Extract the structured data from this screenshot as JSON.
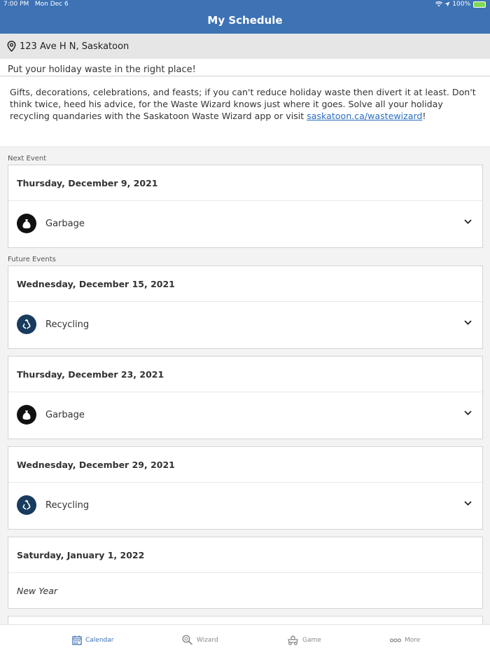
{
  "status": {
    "time": "7:00 PM",
    "date": "Mon Dec 6",
    "battery": "100%"
  },
  "header": {
    "title": "My Schedule"
  },
  "address": "123 Ave H  N, Saskatoon",
  "notice": {
    "title": "Put your holiday waste in the right place!",
    "body_before": "Gifts, decorations, celebrations, and feasts; if you can't reduce holiday waste then divert it at least. Don't think twice, heed his advice, for the Waste Wizard knows just where it goes. Solve all your holiday recycling quandaries with the Saskatoon Waste Wizard app or visit ",
    "link": "saskatoon.ca/wastewizard",
    "body_after": "!"
  },
  "sections": {
    "next": "Next Event",
    "future": "Future Events"
  },
  "events": [
    {
      "date": "Thursday, December 9, 2021",
      "type": "Garbage"
    },
    {
      "date": "Wednesday, December 15, 2021",
      "type": "Recycling"
    },
    {
      "date": "Thursday, December 23, 2021",
      "type": "Garbage"
    },
    {
      "date": "Wednesday, December 29, 2021",
      "type": "Recycling"
    },
    {
      "date": "Saturday, January 1, 2022",
      "note": "New Year"
    }
  ],
  "tabs": [
    {
      "label": "Calendar",
      "icon": "calendar-icon",
      "active": true
    },
    {
      "label": "Wizard",
      "icon": "magnifier-icon"
    },
    {
      "label": "Game",
      "icon": "game-icon"
    },
    {
      "label": "More",
      "icon": "more-icon"
    }
  ],
  "colors": {
    "primary": "#3d72b5",
    "recycling_icon": "#183b5e",
    "garbage_icon": "#111111"
  }
}
